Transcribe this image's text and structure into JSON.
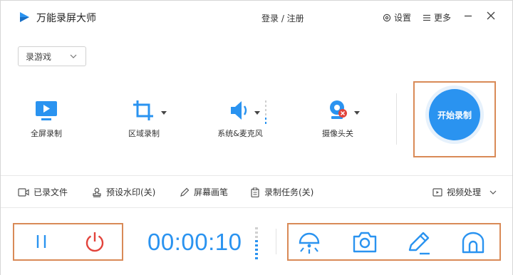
{
  "app": {
    "title": "万能录屏大师",
    "login": "登录 / 注册",
    "settings": "设置",
    "more": "更多"
  },
  "mode": {
    "selected": "录游戏"
  },
  "tools": [
    {
      "label": "全屏录制",
      "icon": "fullscreen-icon"
    },
    {
      "label": "区域录制",
      "icon": "crop-icon"
    },
    {
      "label": "系统&麦克风",
      "icon": "speaker-icon"
    },
    {
      "label": "摄像头关",
      "icon": "webcam-icon"
    }
  ],
  "record_button": {
    "label": "开始录制"
  },
  "menu": {
    "recorded_files": "已录文件",
    "watermark": "预设水印(关)",
    "screen_pen": "屏幕画笔",
    "record_task": "录制任务(关)",
    "video_processing": "视频处理"
  },
  "control": {
    "timer": "00:00:10"
  },
  "colors": {
    "accent": "#2a93f0",
    "highlight_border": "#d98a57",
    "power_red": "#e2433b"
  }
}
